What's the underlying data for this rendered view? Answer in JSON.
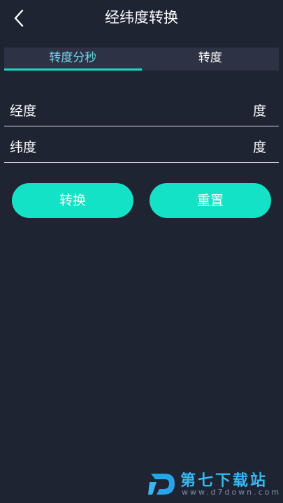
{
  "header": {
    "title": "经纬度转换"
  },
  "tabs": [
    {
      "label": "转度分秒",
      "active": true
    },
    {
      "label": "转度",
      "active": false
    }
  ],
  "fields": {
    "longitude": {
      "label": "经度",
      "value": "",
      "unit": "度"
    },
    "latitude": {
      "label": "纬度",
      "value": "",
      "unit": "度"
    }
  },
  "buttons": {
    "convert": "转换",
    "reset": "重置"
  },
  "watermark": {
    "text": "第七下载站",
    "url": "www.d7down.com"
  },
  "colors": {
    "background": "#1f2433",
    "accent": "#14e2c6",
    "tab_bg": "#2e3245",
    "active_tab_text": "#6fd6ee"
  }
}
